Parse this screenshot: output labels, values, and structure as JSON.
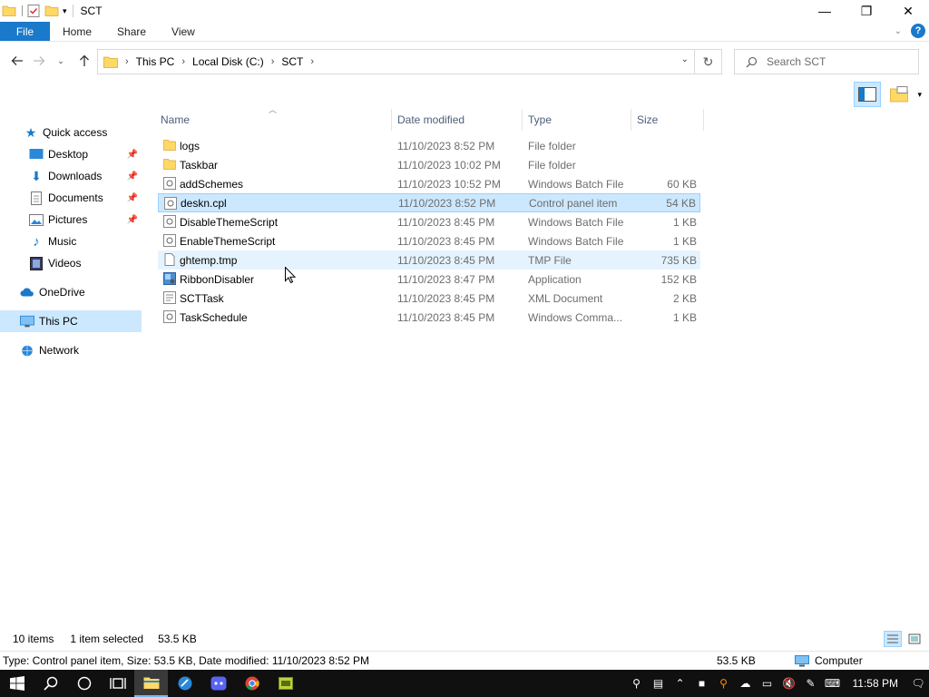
{
  "window": {
    "title": "SCT",
    "controls": {
      "minimize": "—",
      "maximize": "❐",
      "close": "✕"
    }
  },
  "ribbon": {
    "tabs": [
      "File",
      "Home",
      "Share",
      "View"
    ],
    "help": "?"
  },
  "address": {
    "crumbs": [
      "This PC",
      "Local Disk (C:)",
      "SCT"
    ],
    "search_placeholder": "Search SCT"
  },
  "columns": {
    "name": "Name",
    "date": "Date modified",
    "type": "Type",
    "size": "Size"
  },
  "files": [
    {
      "name": "logs",
      "date": "11/10/2023 8:52 PM",
      "type": "File folder",
      "size": "",
      "icon": "folder-icon"
    },
    {
      "name": "Taskbar",
      "date": "11/10/2023 10:02 PM",
      "type": "File folder",
      "size": "",
      "icon": "folder-icon"
    },
    {
      "name": "addSchemes",
      "date": "11/10/2023 10:52 PM",
      "type": "Windows Batch File",
      "size": "60 KB",
      "icon": "batch-file-icon"
    },
    {
      "name": "deskn.cpl",
      "date": "11/10/2023 8:52 PM",
      "type": "Control panel item",
      "size": "54 KB",
      "icon": "cpl-file-icon"
    },
    {
      "name": "DisableThemeScript",
      "date": "11/10/2023 8:45 PM",
      "type": "Windows Batch File",
      "size": "1 KB",
      "icon": "batch-file-icon"
    },
    {
      "name": "EnableThemeScript",
      "date": "11/10/2023 8:45 PM",
      "type": "Windows Batch File",
      "size": "1 KB",
      "icon": "batch-file-icon"
    },
    {
      "name": "ghtemp.tmp",
      "date": "11/10/2023 8:45 PM",
      "type": "TMP File",
      "size": "735 KB",
      "icon": "blank-file-icon"
    },
    {
      "name": "RibbonDisabler",
      "date": "11/10/2023 8:47 PM",
      "type": "Application",
      "size": "152 KB",
      "icon": "application-icon"
    },
    {
      "name": "SCTTask",
      "date": "11/10/2023 8:45 PM",
      "type": "XML Document",
      "size": "2 KB",
      "icon": "xml-file-icon"
    },
    {
      "name": "TaskSchedule",
      "date": "11/10/2023 8:45 PM",
      "type": "Windows Comma...",
      "size": "1 KB",
      "icon": "cmd-file-icon"
    }
  ],
  "nav": {
    "quick_access": "Quick access",
    "desktop": "Desktop",
    "downloads": "Downloads",
    "documents": "Documents",
    "pictures": "Pictures",
    "music": "Music",
    "videos": "Videos",
    "onedrive": "OneDrive",
    "this_pc": "This PC",
    "network": "Network"
  },
  "status": {
    "count": "10 items",
    "selected": "1 item selected",
    "selected_size": "53.5 KB"
  },
  "details": {
    "text": "Type: Control panel item, Size: 53.5 KB, Date modified: 11/10/2023 8:52 PM",
    "size": "53.5 KB",
    "location": "Computer"
  },
  "taskbar": {
    "clock": "11:58 PM"
  },
  "colors": {
    "accent": "#1979ca",
    "selection": "#cce8ff",
    "selection_border": "#99d1ff",
    "folder": "#ffd866"
  }
}
